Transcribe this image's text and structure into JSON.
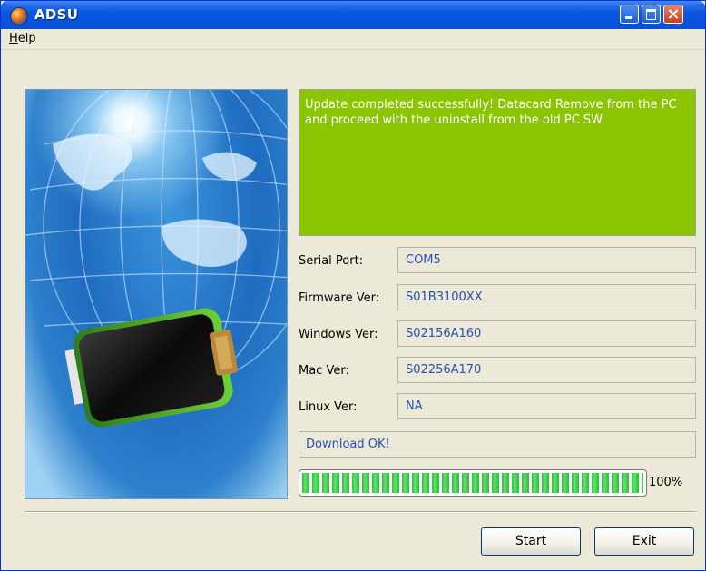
{
  "window": {
    "title": "ADSU"
  },
  "menu": {
    "help_label": "Help"
  },
  "status": {
    "message": "Update completed successfully! Datacard Remove from the PC and proceed with the uninstall from the old PC SW."
  },
  "fields": [
    {
      "label": "Serial Port:",
      "value": "COM5"
    },
    {
      "label": "Firmware Ver:",
      "value": "S01B3100XX"
    },
    {
      "label": "Windows Ver:",
      "value": "S02156A160"
    },
    {
      "label": "Mac Ver:",
      "value": "S02256A170"
    },
    {
      "label": "Linux Ver:",
      "value": "NA"
    }
  ],
  "download": {
    "message": "Download OK!"
  },
  "progress": {
    "value": 100,
    "label": "100%"
  },
  "buttons": {
    "start_label": "Start",
    "exit_label": "Exit"
  },
  "colors": {
    "status_bg": "#8bc400",
    "value_text": "#2850b4",
    "progress_green": "#2cbe3a"
  }
}
